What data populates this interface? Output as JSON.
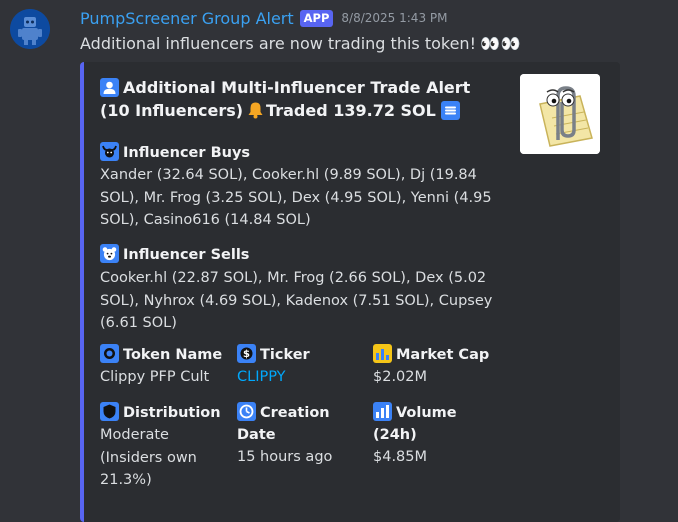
{
  "message": {
    "username": "PumpScreener Group Alert",
    "badge": "APP",
    "timestamp": "8/8/2025 1:43 PM",
    "text": "Additional influencers are now trading this token!",
    "emoji": "👀👀"
  },
  "embed": {
    "accent_color": "#5865f2",
    "title_line1": "Additional Multi-Influencer Trade Alert",
    "title_line2_a": "(10 Influencers)",
    "title_line2_b": "Traded 139.72 SOL",
    "buys_title": "Influencer Buys",
    "buys_text": "Xander (32.64 SOL), Cooker.hl (9.89 SOL), Dj (19.84 SOL), Mr. Frog (3.25 SOL), Dex (4.95 SOL), Yenni (4.95 SOL), Casino616 (14.84 SOL)",
    "sells_title": "Influencer Sells",
    "sells_text": "Cooker.hl (22.87 SOL), Mr. Frog (2.66 SOL), Dex (5.02 SOL), Nyhrox (4.69 SOL), Kadenox (7.51 SOL), Cupsey (6.61 SOL)",
    "fields": {
      "token_name": {
        "name": "Token Name",
        "value": "Clippy PFP Cult",
        "icon": "coin-icon"
      },
      "ticker": {
        "name": "Ticker",
        "value": "CLIPPY",
        "icon": "dollar-icon"
      },
      "market_cap": {
        "name": "Market Cap",
        "value": "$2.02M",
        "icon": "bar-chart-icon"
      },
      "distribution": {
        "name": "Distribution",
        "value": "Moderate (Insiders own 21.3%)",
        "icon": "shield-icon"
      },
      "creation_date": {
        "name": "Creation Date",
        "value": "15 hours ago",
        "icon": "clock-icon"
      },
      "volume": {
        "name": "Volume (24h)",
        "value": "$4.85M",
        "icon": "volume-bars-icon"
      }
    }
  }
}
